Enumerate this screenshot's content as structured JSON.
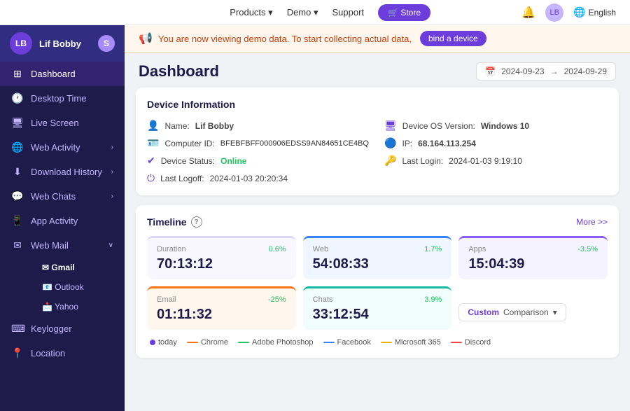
{
  "topnav": {
    "products_label": "Products ▾",
    "demo_label": "Demo ▾",
    "support_label": "Support",
    "store_label": "🛒 Store",
    "lang_label": "English"
  },
  "sidebar": {
    "username": "Lif Bobby",
    "s_icon": "S",
    "items": [
      {
        "id": "dashboard",
        "label": "Dashboard",
        "icon": "⊞",
        "active": true
      },
      {
        "id": "desktop-time",
        "label": "Desktop Time",
        "icon": "🕐",
        "active": false
      },
      {
        "id": "live-screen",
        "label": "Live Screen",
        "icon": "🖥",
        "active": false
      },
      {
        "id": "web-activity",
        "label": "Web Activity",
        "icon": "🌐",
        "active": false,
        "hasChevron": true
      },
      {
        "id": "download-history",
        "label": "Download History",
        "icon": "⬇",
        "active": false,
        "hasChevron": true
      },
      {
        "id": "web-chats",
        "label": "Web Chats",
        "icon": "💬",
        "active": false,
        "hasChevron": true
      },
      {
        "id": "app-activity",
        "label": "App Activity",
        "icon": "📱",
        "active": false
      },
      {
        "id": "web-mail",
        "label": "Web Mail",
        "icon": "✉",
        "active": false,
        "hasChevron": true,
        "expanded": true
      },
      {
        "id": "keylogger",
        "label": "Keylogger",
        "icon": "⌨",
        "active": false
      },
      {
        "id": "location",
        "label": "Location",
        "icon": "📍",
        "active": false
      }
    ],
    "webmail_subs": [
      {
        "id": "gmail",
        "label": "Gmail",
        "active": true
      },
      {
        "id": "outlook",
        "label": "Outlook",
        "active": false
      },
      {
        "id": "yahoo",
        "label": "Yahoo",
        "active": false
      }
    ]
  },
  "alert": {
    "message": "You are now viewing demo data. To start collecting actual data,",
    "cta": "bind a device"
  },
  "dashboard": {
    "title": "Dashboard",
    "date_start": "2024-09-23",
    "date_separator": "→",
    "date_end": "2024-09-29"
  },
  "device_info": {
    "section_title": "Device Information",
    "name_label": "Name:",
    "name_value": "Lif Bobby",
    "os_label": "Device OS Version:",
    "os_value": "Windows 10",
    "computer_id_label": "Computer ID:",
    "computer_id_value": "BFEBFBFF000906EDSS9AN84651CE4BQ",
    "ip_label": "IP:",
    "ip_value": "68.164.113.254",
    "status_label": "Device Status:",
    "status_value": "Online",
    "last_login_label": "Last Login:",
    "last_login_value": "2024-01-03 9:19:10",
    "last_logoff_label": "Last Logoff:",
    "last_logoff_value": "2024-01-03 20:20:34"
  },
  "timeline": {
    "section_title": "Timeline",
    "more_label": "More >>",
    "stats": [
      {
        "id": "duration",
        "label": "Duration",
        "pct": "0.6%",
        "trend": "up",
        "value": "70:13:12",
        "color": "default"
      },
      {
        "id": "web",
        "label": "Web",
        "pct": "1.7%",
        "trend": "up",
        "value": "54:08:33",
        "color": "blue"
      },
      {
        "id": "apps",
        "label": "Apps",
        "pct": "-3.5%",
        "trend": "up",
        "value": "15:04:39",
        "color": "purple"
      }
    ],
    "stats2": [
      {
        "id": "email",
        "label": "Email",
        "pct": "-25%",
        "trend": "up",
        "value": "01:11:32",
        "color": "orange"
      },
      {
        "id": "chats",
        "label": "Chats",
        "pct": "3.9%",
        "trend": "up",
        "value": "33:12:54",
        "color": "teal"
      }
    ],
    "dropdown_label": "Custom",
    "dropdown_text": "Comparison",
    "legend": [
      {
        "id": "today",
        "label": "today",
        "color": "#6c3ddb"
      },
      {
        "id": "chrome",
        "label": "Chrome",
        "color": "#f97316"
      },
      {
        "id": "adobe",
        "label": "Adobe Photoshop",
        "color": "#22c55e"
      },
      {
        "id": "facebook",
        "label": "Facebook",
        "color": "#3b82f6"
      },
      {
        "id": "ms365",
        "label": "Microsoft 365",
        "color": "#eab308"
      },
      {
        "id": "discord",
        "label": "Discord",
        "color": "#ef4444"
      }
    ]
  }
}
